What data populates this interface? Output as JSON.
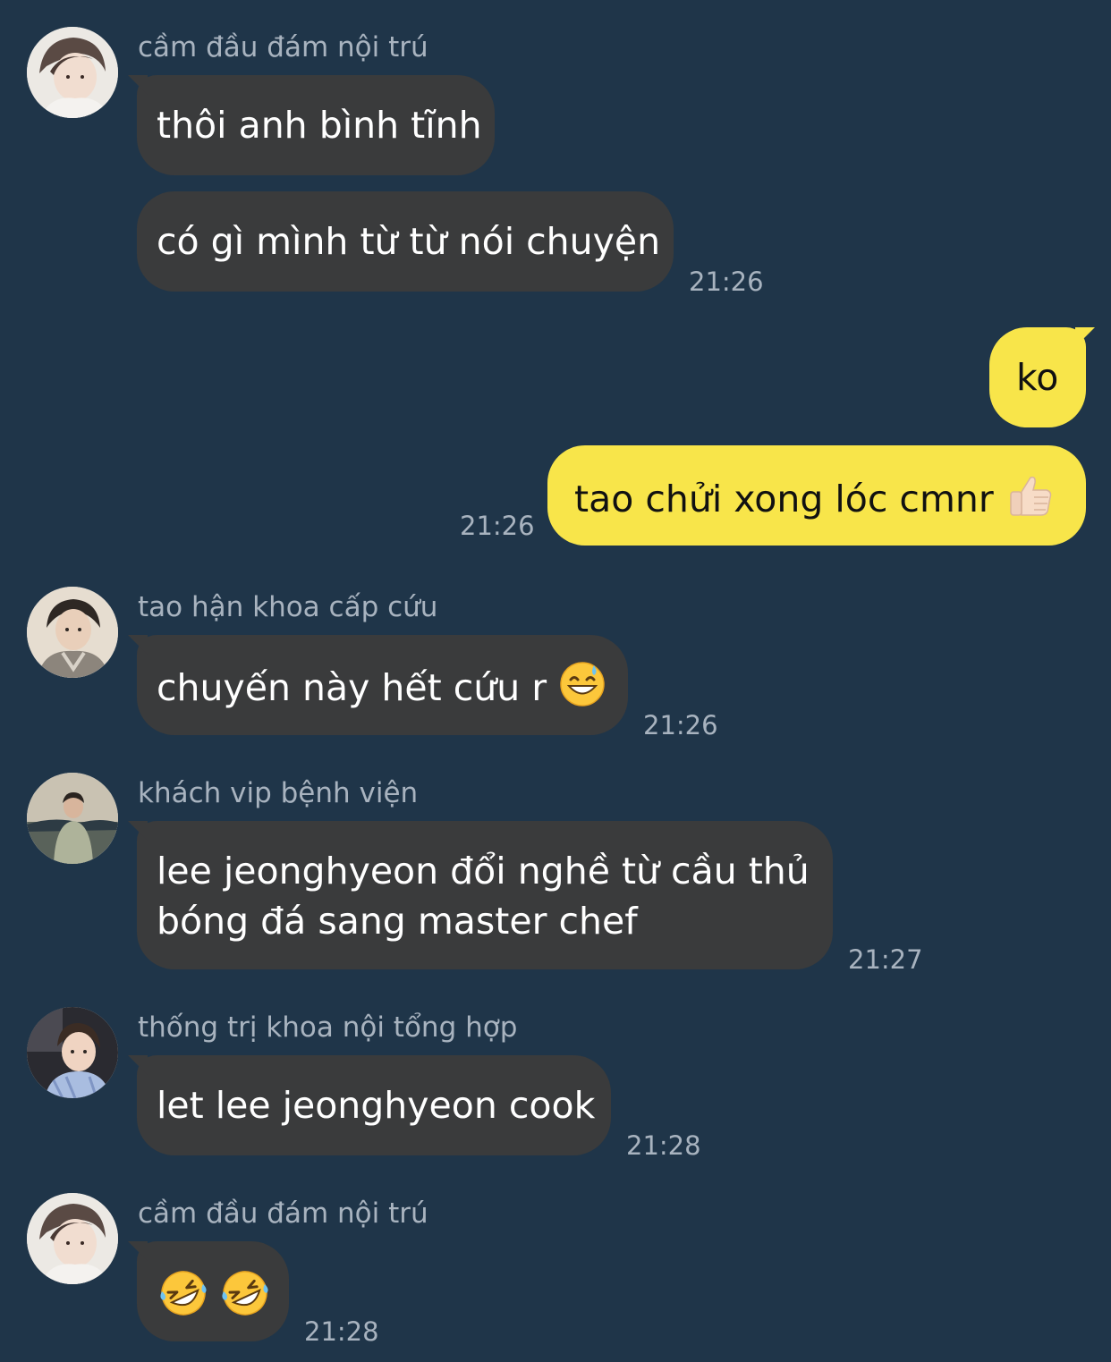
{
  "messages": [
    {
      "sender": "cầm đầu đám nội trú",
      "lines": [
        "thôi anh bình tĩnh",
        "có gì mình từ từ nói chuyện"
      ],
      "time": "21:26"
    },
    {
      "mine": true,
      "lines": [
        "ko",
        "tao chửi xong lóc cmnr"
      ],
      "emoji_names": [
        "thumbs-up-icon"
      ],
      "time": "21:26"
    },
    {
      "sender": "tao hận khoa cấp cứu",
      "lines": [
        "chuyến này hết cứu r"
      ],
      "emoji_names": [
        "grinning-sweat-icon"
      ],
      "time": "21:26"
    },
    {
      "sender": "khách vip bệnh viện",
      "lines": [
        "lee jeonghyeon đổi nghề từ cầu thủ bóng đá sang master chef"
      ],
      "time": "21:27"
    },
    {
      "sender": "thống trị khoa nội tổng hợp",
      "lines": [
        "let lee jeonghyeon cook"
      ],
      "time": "21:28"
    },
    {
      "sender": "cầm đầu đám nội trú",
      "lines": [
        ""
      ],
      "emoji_names": [
        "rolling-laughing-icon",
        "rolling-laughing-icon"
      ],
      "time": "21:28"
    }
  ],
  "colors": {
    "background": "#1f3549",
    "bubble_other": "#3a3b3c",
    "bubble_mine": "#f8e54a",
    "meta_text": "#a8b3bf"
  }
}
